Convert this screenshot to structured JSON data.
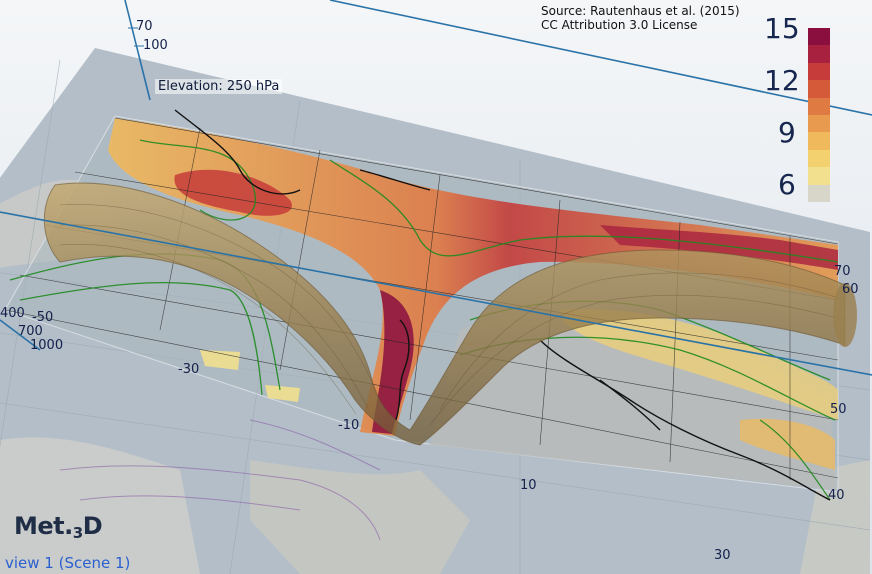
{
  "source": {
    "line1": "Source: Rautenhaus et al. (2015)",
    "line2": "CC Attribution 3.0 License"
  },
  "elevation_label": "Elevation: 250 hPa",
  "logo": {
    "main": "Met.",
    "sub": "3",
    "tail": "D"
  },
  "view_label": "view 1 (Scene 1)",
  "colorbar": {
    "ticks": [
      "15",
      "12",
      "9",
      "6"
    ],
    "colors": [
      "#8a0f3f",
      "#a8213f",
      "#c53c3a",
      "#d55a39",
      "#e07a43",
      "#e89a4f",
      "#efb95c",
      "#f3d16e",
      "#f2e08e",
      "#d8d6c9"
    ]
  },
  "pressure_axis_left": {
    "ticks": [
      "400",
      "700",
      "1000"
    ]
  },
  "pressure_axis_top": {
    "ticks": [
      "70",
      "100"
    ]
  },
  "lat_labels": [
    "70",
    "60",
    "50",
    "40"
  ],
  "lon_labels": [
    "-50",
    "-30",
    "-10",
    "10",
    "30"
  ],
  "colors": {
    "land": "#bfc4c4",
    "ocean_map": "#b2c0cb",
    "jet_tube": "#a58a54",
    "contour_green": "#1f8a1f",
    "contour_purple": "#8a5ea8",
    "axis_blue": "#2a73a8"
  }
}
